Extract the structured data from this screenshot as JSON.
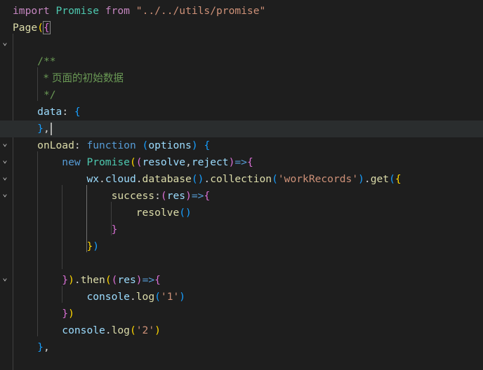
{
  "editor": {
    "language": "javascript",
    "colors": {
      "background": "#1e1e1e",
      "current_line": "#2a2d2e",
      "keyword": "#569cd6",
      "control_keyword": "#c586c0",
      "function": "#dcdcaa",
      "string": "#ce9178",
      "comment": "#6a9955",
      "variable": "#9cdcfe",
      "class": "#4ec9b0",
      "bracket_level_1": "#ffd700",
      "bracket_level_2": "#da70d6",
      "bracket_level_3": "#179fff"
    },
    "lines": {
      "l1": {
        "t1": "import",
        "t2": " ",
        "t3": "Promise",
        "t4": " ",
        "t5": "from",
        "t6": " ",
        "t7": "\"../../utils/promise\""
      },
      "l2": {
        "t1": "Page",
        "t2": "(",
        "t3": "{"
      },
      "l3": {},
      "l4": {
        "t1": "    ",
        "t2": "/**"
      },
      "l5": {
        "t1": "     ",
        "t2": "* 页面的初始数据"
      },
      "l6": {
        "t1": "     ",
        "t2": "*/"
      },
      "l7": {
        "t1": "    ",
        "t2": "data",
        ":": "",
        "t3": ": ",
        "t4": "{"
      },
      "l8": {
        "t1": "    ",
        "t2": "}",
        "t3": ","
      },
      "l9": {
        "t1": "    ",
        "t2": "onLoad",
        "t3": ": ",
        "t4": "function",
        "t5": " ",
        "t6": "(",
        "t7": "options",
        "t8": ")",
        "t9": " ",
        "t10": "{"
      },
      "l10": {
        "t1": "        ",
        "t2": "new",
        "t3": " ",
        "t4": "Promise",
        "t5": "(",
        "t6": "(",
        "t7": "resolve",
        "t8": ",",
        "t9": "reject",
        "t10": ")",
        "t11": "=>",
        "t12": "{"
      },
      "l11": {
        "t1": "            ",
        "t2": "wx",
        "t3": ".",
        "t4": "cloud",
        "t5": ".",
        "t6": "database",
        "t7": "()",
        "t8": ".",
        "t9": "collection",
        "t10": "(",
        "t11": "'workRecords'",
        "t12": ")",
        "t13": ".",
        "t14": "get",
        "t15": "(",
        "t16": "{"
      },
      "l12": {
        "t1": "                ",
        "t2": "success",
        "t3": ":",
        "t4": "(",
        "t5": "res",
        "t6": ")",
        "t7": "=>",
        "t8": "{"
      },
      "l13": {
        "t1": "                    ",
        "t2": "resolve",
        "t3": "()"
      },
      "l14": {
        "t1": "                ",
        "t2": "}"
      },
      "l15": {
        "t1": "            ",
        "t2": "}",
        "t3": ")"
      },
      "l16": {},
      "l17": {
        "t1": "        ",
        "t2": "}",
        "t3": ")",
        ".": "",
        "t4": ".",
        "t5": "then",
        "t6": "(",
        "t7": "(",
        "t8": "res",
        "t9": ")",
        "t10": "=>",
        "t11": "{"
      },
      "l18": {
        "t1": "            ",
        "t2": "console",
        "t3": ".",
        "t4": "log",
        "t5": "(",
        "t6": "'1'",
        "t7": ")"
      },
      "l19": {
        "t1": "        ",
        "t2": "}",
        "t3": ")"
      },
      "l20": {
        "t1": "        ",
        "t2": "console",
        "t3": ".",
        "t4": "log",
        "t5": "(",
        "t6": "'2'",
        "t7": ")"
      },
      "l21": {
        "t1": "    ",
        "t2": "}",
        "t3": ","
      }
    },
    "fold_icon": "chevron-down-icon",
    "fold_glyph": "⌄"
  }
}
